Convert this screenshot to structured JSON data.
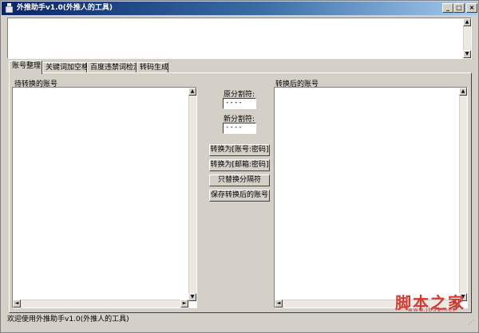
{
  "window": {
    "title": "外推助手v1.0(外推人的工具)",
    "min_label": "_",
    "max_label": "□",
    "close_label": "×"
  },
  "tabs": [
    {
      "label": "账号整理",
      "active": true
    },
    {
      "label": "关键词加空格",
      "active": false
    },
    {
      "label": "百度违禁词检测",
      "active": false
    },
    {
      "label": "转码生成",
      "active": false
    }
  ],
  "left_panel": {
    "label": "待转换的账号"
  },
  "right_panel": {
    "label": "转换后的账号"
  },
  "separators": {
    "original_label": "原分割符:",
    "original_value": "----",
    "new_label": "新分割符:",
    "new_value": "----"
  },
  "buttons": {
    "convert_account_password": "转换为[账号:密码]",
    "convert_email_password": "转换为[邮箱:密码]",
    "replace_separator": "只替换分隔符",
    "save_converted": "保存转换后的账号"
  },
  "status": {
    "text": "欢迎使用外推助手v1.0(外推人的工具)"
  },
  "watermark": {
    "main": "脚本之家",
    "sub": "www.jb51.net"
  },
  "arrows": {
    "up": "▲",
    "down": "▼",
    "left": "◄",
    "right": "►"
  }
}
